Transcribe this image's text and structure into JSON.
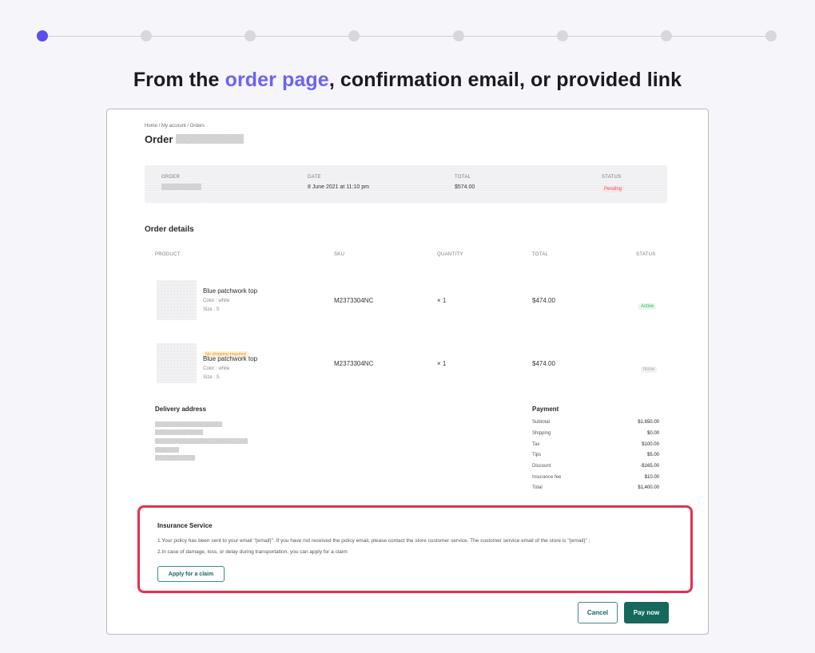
{
  "headline": {
    "prefix": "From the ",
    "accent": "order page",
    "suffix": ", confirmation email, or provided link",
    "accent_color": "#6b63f6"
  },
  "stepper": {
    "total_steps": 8,
    "active_step": 1,
    "active_color": "#5b4ef0"
  },
  "breadcrumb": "Home / My account / Orders",
  "order_title": "Order",
  "summary": {
    "order_label": "ORDER",
    "date_label": "DATE",
    "date_value": "8 June 2021 at 11:10 pm",
    "total_label": "TOTAL",
    "total_value": "$574.00",
    "status_label": "STATUS",
    "status_value": "Pending"
  },
  "details": {
    "title": "Order details",
    "headers": {
      "product": "PRODUCT",
      "sku": "SKU",
      "quantity": "QUANTITY",
      "total": "TOTAL",
      "status": "STATUS"
    },
    "rows": [
      {
        "tag": "",
        "name": "Blue patchwork top",
        "color": "Color : white",
        "size": "Size : S",
        "sku": "M2373304NC",
        "qty": "× 1",
        "total": "$474.00",
        "status": "Active"
      },
      {
        "tag": "No shipping required",
        "name": "Blue patchwork top",
        "color": "Color : white",
        "size": "Size : S",
        "sku": "M2373304NC",
        "qty": "× 1",
        "total": "$474.00",
        "status": "None"
      }
    ]
  },
  "delivery": {
    "title": "Delivery address"
  },
  "payment": {
    "title": "Payment",
    "rows": [
      {
        "label": "Subtotal",
        "value": "$1,650.00"
      },
      {
        "label": "Shipping",
        "value": "$0.00"
      },
      {
        "label": "Tax",
        "value": "$100.00"
      },
      {
        "label": "Tips",
        "value": "$5.00"
      },
      {
        "label": "Discount",
        "value": "-$165.00"
      },
      {
        "label": "Insurance fee",
        "value": "$10.00"
      },
      {
        "label": "Total",
        "value": "$1,400.00"
      }
    ]
  },
  "insurance": {
    "title": "Insurance Service",
    "line1": "1.Your policy has been sent to your email \"{email}\". If you have not received the policy email, please contact the store customer service. The customer service email of the store is \"{email}\" ;",
    "line2": "2.In case of damage, loss, or delay during transportation, you can apply for a claim",
    "claim_button": "Apply for a claim"
  },
  "actions": {
    "cancel": "Cancel",
    "pay": "Pay now"
  },
  "colors": {
    "highlight_border": "#e5304e",
    "primary_button": "#14695c"
  }
}
